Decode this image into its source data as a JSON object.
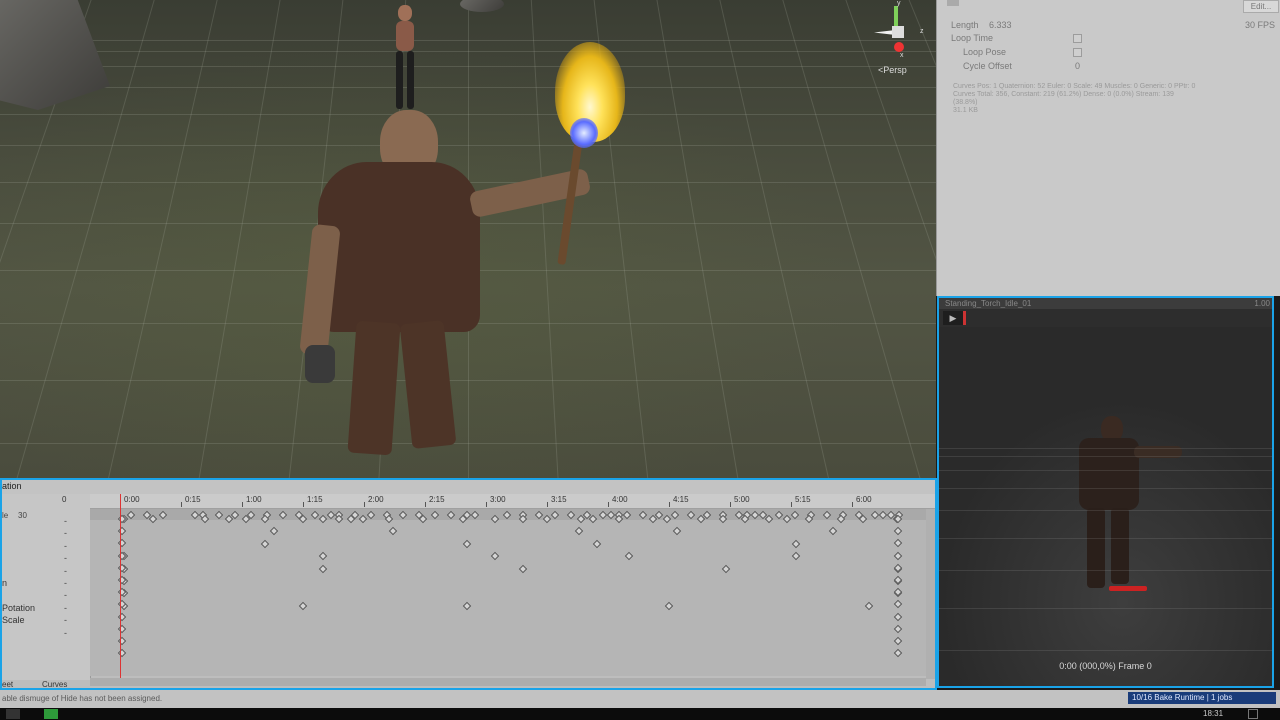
{
  "scene": {
    "gizmo_label": "<Persp",
    "gizmo_axis_x": "x",
    "gizmo_axis_y": "y",
    "gizmo_axis_z": "z"
  },
  "inspector": {
    "edit_button": "Edit...",
    "length_label": "Length",
    "length_value": "6.333",
    "fps_value": "30 FPS",
    "loop_time_label": "Loop Time",
    "loop_pose_label": "Loop Pose",
    "cycle_offset_label": "Cycle Offset",
    "cycle_offset_value": "0",
    "stats_line1": "Curves Pos: 1 Quaternion: 52 Euler: 0 Scale: 49 Muscles: 0 Generic: 0 PPtr: 0",
    "stats_line2": "Curves Total: 356, Constant: 219 (61.2%) Dense: 0 (0.0%) Stream: 139",
    "stats_line3": "(38.8%)",
    "stats_line4": "31.1 KB"
  },
  "preview": {
    "title": "Standing_Torch_Idle_01",
    "corner_label": "1.00",
    "play_label": "▶",
    "frame_text": "0:00 (000,0%) Frame 0"
  },
  "animation": {
    "tab_label": "ation",
    "samples_label": "le",
    "samples_value": "30",
    "properties": [
      "",
      "",
      "",
      "",
      "",
      "n",
      "",
      "Potation",
      "Scale",
      ""
    ],
    "left_tabs": [
      "eet",
      "Curves"
    ],
    "ruler_ticks": [
      "0:00",
      "0:15",
      "1:00",
      "1:15",
      "2:00",
      "2:15",
      "3:00",
      "3:15",
      "4:00",
      "4:15",
      "5:00",
      "5:15",
      "6:00"
    ],
    "ruler_first": "0"
  },
  "status": {
    "message": "able dismuge of Hide has not been assigned.",
    "bake_text": "10/16 Bake Runtime | 1 jobs"
  },
  "taskbar": {
    "clock": "18:31"
  }
}
